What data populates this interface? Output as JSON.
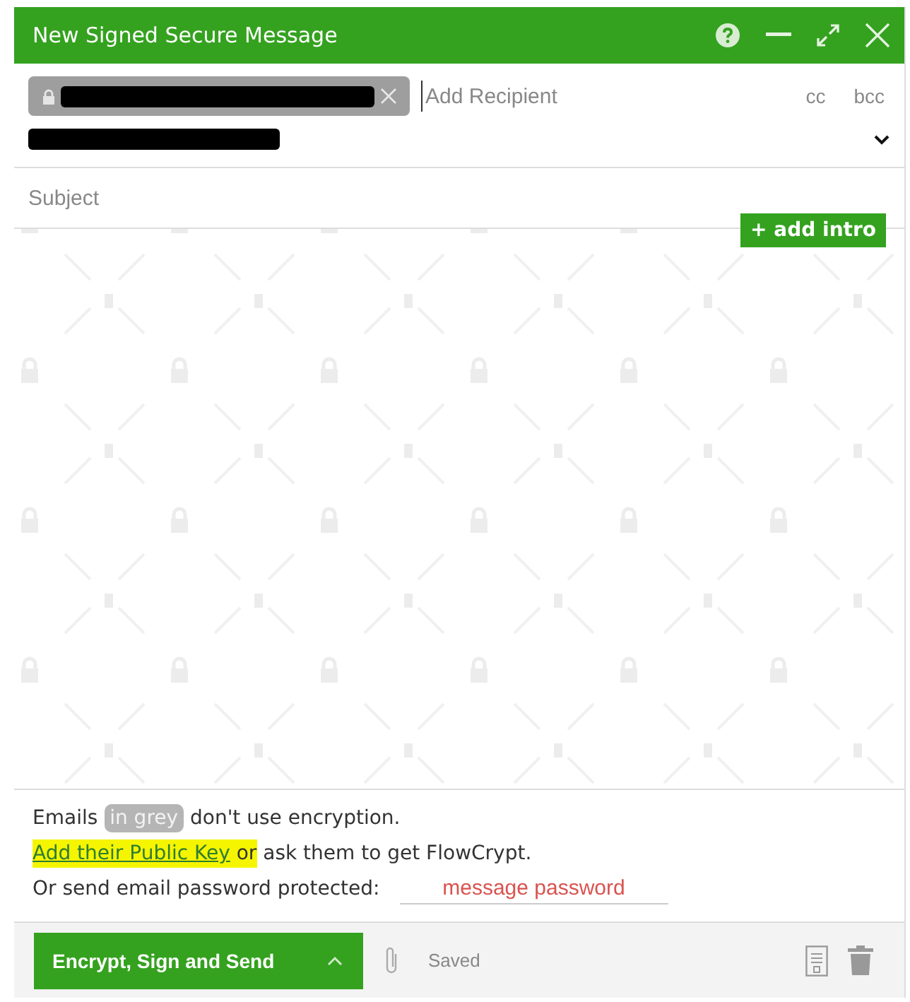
{
  "window": {
    "title": "New Signed Secure Message"
  },
  "recipients": {
    "placeholder": "Add Recipient",
    "cc": "cc",
    "bcc": "bcc"
  },
  "subject": {
    "placeholder": "Subject"
  },
  "add_intro": "+ add intro",
  "notice": {
    "emails_before": "Emails",
    "grey_chip": "in grey",
    "emails_after": "don't use encryption.",
    "link": "Add their Public Key",
    "highlighted": "or",
    "rest": "ask them to get FlowCrypt.",
    "password_label": "Or send email password protected:",
    "password_placeholder": "message password"
  },
  "footer": {
    "send_button": "Encrypt, Sign and Send",
    "status": "Saved"
  }
}
